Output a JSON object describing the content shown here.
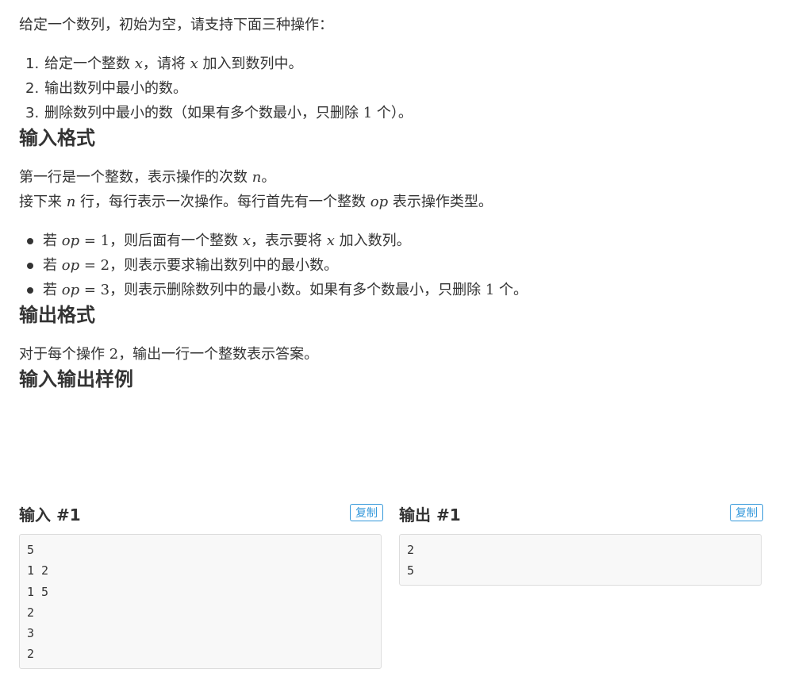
{
  "intro": "给定一个数列，初始为空，请支持下面三种操作：",
  "operations": [
    {
      "marker": "1.",
      "before": "给定一个整数 ",
      "var": "x",
      "mid": "，请将 ",
      "var2": "x",
      "after": " 加入到数列中。"
    },
    {
      "marker": "2.",
      "text": "输出数列中最小的数。"
    },
    {
      "marker": "3.",
      "before": "删除数列中最小的数（如果有多个数最小，只删除 ",
      "num": "1",
      "after": " 个）。"
    }
  ],
  "input_format": {
    "heading": "输入格式",
    "line1_before": "第一行是一个整数，表示操作的次数 ",
    "line1_var": "n",
    "line1_after": "。",
    "line2_before": "接下来 ",
    "line2_var": "n",
    "line2_mid": " 行，每行表示一次操作。每行首先有一个整数 ",
    "line2_var2": "op",
    "line2_after": " 表示操作类型。",
    "cases": [
      {
        "before": "若 ",
        "var": "op",
        "eq": " = ",
        "num": "1",
        "after": "，则后面有一个整数 ",
        "var2": "x",
        "after2": "，表示要将 ",
        "var3": "x",
        "after3": " 加入数列。"
      },
      {
        "before": "若 ",
        "var": "op",
        "eq": " = ",
        "num": "2",
        "after": "，则表示要求输出数列中的最小数。"
      },
      {
        "before": "若 ",
        "var": "op",
        "eq": " = ",
        "num": "3",
        "after": "，则表示删除数列中的最小数。如果有多个数最小，只删除 ",
        "num2": "1",
        "after2": " 个。"
      }
    ]
  },
  "output_format": {
    "heading": "输出格式",
    "before": "对于每个操作 ",
    "num": "2",
    "after": "，输出一行一个整数表示答案。"
  },
  "samples": {
    "heading": "输入输出样例",
    "input_title": "输入 #1",
    "output_title": "输出 #1",
    "copy_label": "复制",
    "input_lines": [
      "5",
      "1 2",
      "1 5",
      "2",
      "3",
      "2"
    ],
    "output_lines": [
      "2",
      "5"
    ]
  }
}
